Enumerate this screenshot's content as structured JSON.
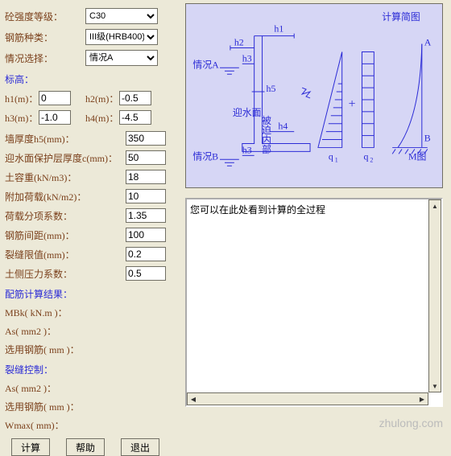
{
  "dropdowns": {
    "strength_label": "砼强度等级：",
    "strength_value": "C30",
    "steel_label": "钢筋种类：",
    "steel_value": "III级(HRB400)",
    "situation_label": "情况选择：",
    "situation_value": "情况A"
  },
  "elev": {
    "heading": "标高：",
    "h1_label": "h1(m)：",
    "h1": "0",
    "h2_label": "h2(m)：",
    "h2": "-0.5",
    "h3_label": "h3(m)：",
    "h3": "-1.0",
    "h4_label": "h4(m)：",
    "h4": "-4.5"
  },
  "params": {
    "thickness_label": "墙厚度h5(mm)：",
    "thickness": "350",
    "cover_label": "迎水面保护层厚度c(mm)：",
    "cover": "50",
    "soil_weight_label": "土容重(kN/m3)：",
    "soil_weight": "18",
    "extra_load_label": "附加荷载(kN/m2)：",
    "extra_load": "10",
    "load_factor_label": "荷载分项系数：",
    "load_factor": "1.35",
    "bar_spacing_label": "钢筋间距(mm)：",
    "bar_spacing": "100",
    "crack_limit_label": "裂缝限值(mm)：",
    "crack_limit": "0.2",
    "pressure_factor_label": "土侧压力系数：",
    "pressure_factor": "0.5"
  },
  "results": {
    "heading": "配筋计算结果：",
    "mbk_label": "MBk( kN.m )：",
    "as_label": "As( mm2 )：",
    "rebar_label": "选用钢筋(  mm )："
  },
  "crack": {
    "heading": "裂缝控制：",
    "as_label": "As( mm2 )：",
    "rebar_label": "选用钢筋(  mm )：",
    "wmax_label": "Wmax( mm)："
  },
  "buttons": {
    "calc": "计算",
    "help": "帮助",
    "exit": "退出"
  },
  "diagram": {
    "title": "计算简图",
    "sitA": "情况A",
    "sitB": "情况B",
    "h1": "h1",
    "h2": "h2",
    "h3": "h3",
    "h4": "h4",
    "h5": "h5",
    "water": "迎水面",
    "back": "被迫内部",
    "q1": "q",
    "q1s": "1",
    "q2": "q",
    "q2s": "2",
    "m": "M图",
    "A": "A",
    "B": "B"
  },
  "output": {
    "text": "您可以在此处看到计算的全过程"
  },
  "watermark": "zhulong.com"
}
